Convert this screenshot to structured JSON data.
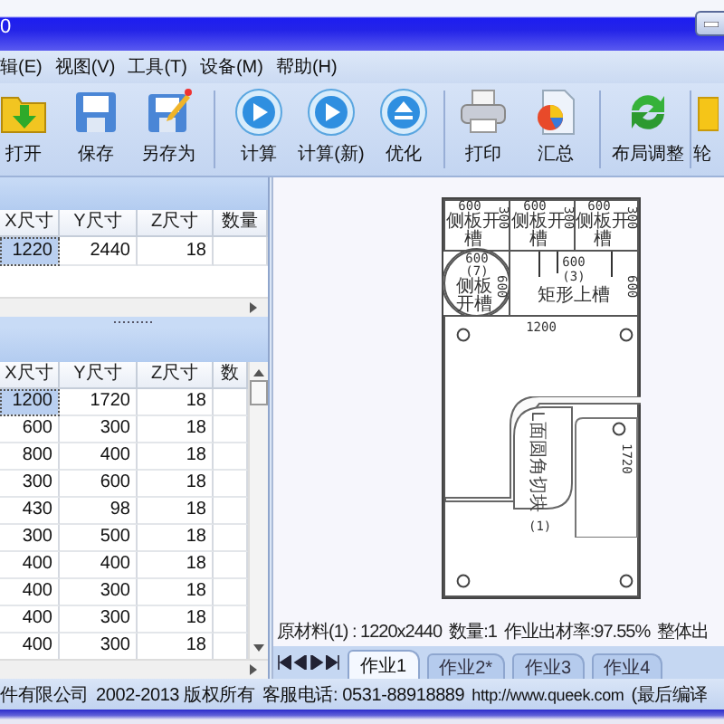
{
  "window": {
    "title": "0"
  },
  "menu": [
    {
      "label": "辑(E)"
    },
    {
      "label": "视图(V)"
    },
    {
      "label": "工具(T)"
    },
    {
      "label": "设备(M)"
    },
    {
      "label": "帮助(H)"
    }
  ],
  "toolbar": [
    [
      {
        "label": "打开",
        "kind": "folder"
      },
      {
        "label": "保存",
        "kind": "save"
      },
      {
        "label": "另存为",
        "kind": "saveas"
      }
    ],
    [
      {
        "label": "计算",
        "kind": "play"
      },
      {
        "label": "计算(新)",
        "kind": "play"
      },
      {
        "label": "优化",
        "kind": "eject"
      }
    ],
    [
      {
        "label": "打印",
        "kind": "printer"
      },
      {
        "label": "汇总",
        "kind": "chart"
      }
    ],
    [
      {
        "label": "布局调整",
        "kind": "refresh"
      }
    ],
    [
      {
        "label": "轮",
        "kind": "outline"
      }
    ]
  ],
  "materials_table": {
    "columns": [
      "X尺寸",
      "Y尺寸",
      "Z尺寸",
      "数量"
    ],
    "rows": [
      {
        "cells": [
          "1220",
          "2440",
          "18"
        ],
        "selected": true
      }
    ]
  },
  "parts_table": {
    "columns": [
      "X尺寸",
      "Y尺寸",
      "Z尺寸",
      "数"
    ],
    "rows": [
      {
        "cells": [
          "1200",
          "1720",
          "18"
        ],
        "selected": true
      },
      {
        "cells": [
          "600",
          "300",
          "18"
        ],
        "selected": false
      },
      {
        "cells": [
          "800",
          "400",
          "18"
        ],
        "selected": false
      },
      {
        "cells": [
          "300",
          "600",
          "18"
        ],
        "selected": false
      },
      {
        "cells": [
          "430",
          "98",
          "18"
        ],
        "selected": false
      },
      {
        "cells": [
          "300",
          "500",
          "18"
        ],
        "selected": false
      },
      {
        "cells": [
          "400",
          "400",
          "18"
        ],
        "selected": false
      },
      {
        "cells": [
          "400",
          "300",
          "18"
        ],
        "selected": false
      },
      {
        "cells": [
          "400",
          "300",
          "18"
        ],
        "selected": false
      },
      {
        "cells": [
          "400",
          "300",
          "18"
        ],
        "selected": false
      }
    ]
  },
  "layout": {
    "pieces": [
      {
        "kind": "slot",
        "size": "600",
        "name": "侧板开槽",
        "side": "300"
      },
      {
        "kind": "slot",
        "size": "600",
        "name": "侧板开槽",
        "side": "300"
      },
      {
        "kind": "slot",
        "size": "600",
        "name": "侧板开槽",
        "side": "300"
      },
      {
        "kind": "round",
        "size": "600",
        "index": "(7)",
        "name": "侧板开槽",
        "side": "600"
      },
      {
        "kind": "rect",
        "size": "600",
        "index": "(3)",
        "name": "矩形上槽",
        "side": "600"
      },
      {
        "kind": "big",
        "size": "1200",
        "index": "(1)",
        "name": "L面圆角切块",
        "side": "1720"
      }
    ]
  },
  "summary": [
    "原材料(1) : 1220x2440",
    "数量:1",
    "作业出材率:97.55%",
    "整体出"
  ],
  "job_tabs": [
    {
      "label": "作业1",
      "selected": true
    },
    {
      "label": "作业2*",
      "selected": false
    },
    {
      "label": "作业3",
      "selected": false
    },
    {
      "label": "作业4",
      "selected": false
    }
  ],
  "status_bar": [
    "件有限公司",
    "2002-2013 版权所有",
    "客服电话: 0531-88918889",
    "http://www.queek.com",
    "(最后编译"
  ]
}
